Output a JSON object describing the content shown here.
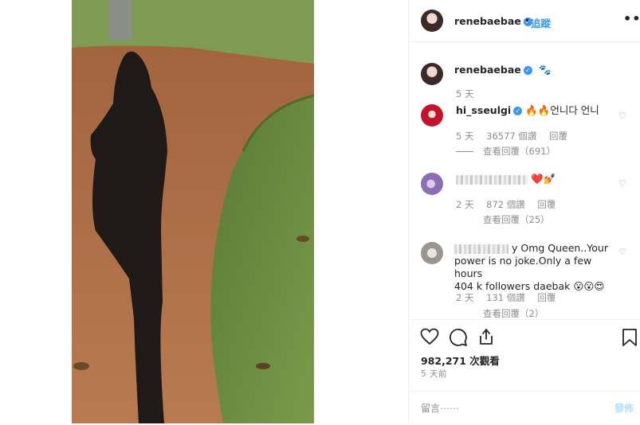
{
  "header": {
    "username": "renebaebae",
    "separator": "•",
    "follow_label": "追蹤",
    "more_label": "•••"
  },
  "caption": {
    "username": "renebaebae",
    "emoji": "🐾",
    "time": "5 天"
  },
  "comments": [
    {
      "username": "hi_sseulgi",
      "text": "🔥🔥언니다 언니",
      "time": "5 天",
      "likes": "36577 個讚",
      "reply_label": "回覆",
      "view_replies": "查看回覆（691）"
    },
    {
      "username": "",
      "text": "❤️💅",
      "time": "2 天",
      "likes": "872 個讚",
      "reply_label": "回覆",
      "view_replies": "查看回覆（25）"
    },
    {
      "username": "",
      "text_line1": "y Omg Queen..Your",
      "text_line2": "power is no joke.Only a few hours",
      "text_line3": "404 k followers daebak 😮😮😍",
      "time": "2 天",
      "likes": "131 個讚",
      "reply_label": "回覆",
      "view_replies": "查看回覆（2）"
    }
  ],
  "stats": {
    "views": "982,271 次觀看",
    "posted": "5 天前"
  },
  "composer": {
    "placeholder": "留言⋯⋯",
    "post_label": "發佈"
  },
  "colors": {
    "accent": "#3897f0",
    "post_disabled": "#b2dffc",
    "secondary_text": "#8e8e8e"
  },
  "icons": [
    "verified-badge-icon",
    "more-options-icon",
    "heart-icon",
    "comment-icon",
    "share-icon",
    "bookmark-icon"
  ]
}
